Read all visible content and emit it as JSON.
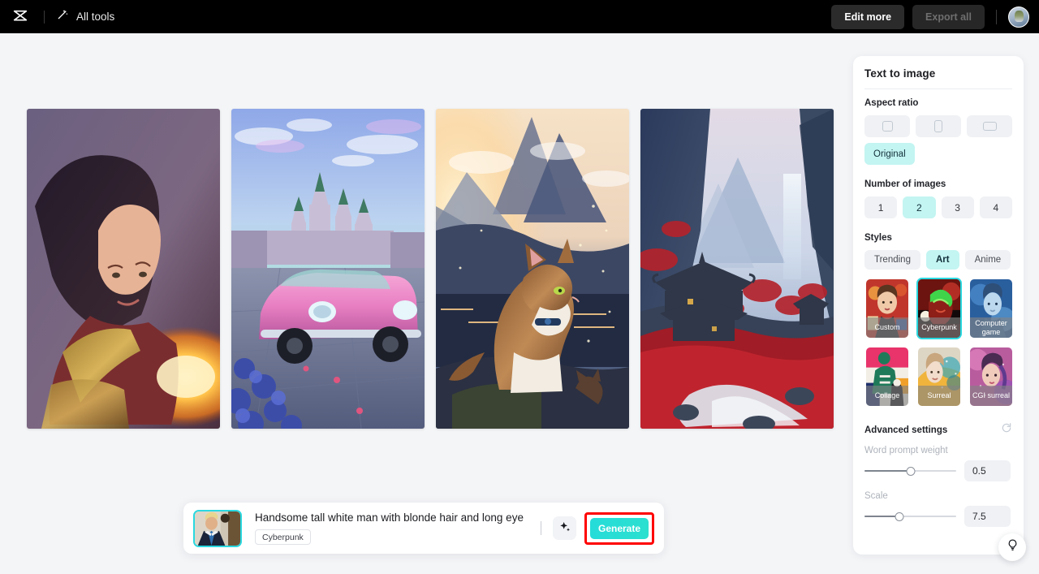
{
  "topbar": {
    "logo_icon": "capcut-logo-icon",
    "all_tools": {
      "icon": "magic-wand-icon",
      "label": "All tools"
    },
    "edit_more_label": "Edit more",
    "export_all_label": "Export all",
    "avatar_alt": "user-avatar"
  },
  "gallery": {
    "items": [
      {
        "name": "fantasy-warrior-woman",
        "alt": "Dark-haired warrior woman in gold armor with fireball"
      },
      {
        "name": "pink-car-castle",
        "alt": "Pink sports car in front of fairytale castle with blue flowers"
      },
      {
        "name": "cat-sunset-mountains",
        "alt": "Tabby cat on a rock at sunset with mountains and kitten"
      },
      {
        "name": "red-valley-pagoda",
        "alt": "Misty mountain valley with pagoda, red foliage and waterfall"
      }
    ]
  },
  "panel": {
    "title": "Text to image",
    "aspect_ratio": {
      "label": "Aspect ratio",
      "options": [
        {
          "icon": "square-ratio-icon",
          "selected": false
        },
        {
          "icon": "portrait-ratio-icon",
          "selected": false
        },
        {
          "icon": "landscape-ratio-icon",
          "selected": false
        }
      ],
      "original_label": "Original",
      "original_selected": true
    },
    "number_of_images": {
      "label": "Number of images",
      "options": [
        "1",
        "2",
        "3",
        "4"
      ],
      "selected": "2"
    },
    "styles": {
      "label": "Styles",
      "tabs": [
        {
          "label": "Trending",
          "active": false
        },
        {
          "label": "Art",
          "active": true
        },
        {
          "label": "Anime",
          "active": false
        }
      ],
      "items": [
        {
          "label": "Custom",
          "selected": false
        },
        {
          "label": "Cyberpunk",
          "selected": true
        },
        {
          "label": "Computer game",
          "selected": false
        },
        {
          "label": "Collage",
          "selected": false
        },
        {
          "label": "Surreal",
          "selected": false
        },
        {
          "label": "CGI surreal",
          "selected": false
        }
      ]
    },
    "advanced": {
      "title": "Advanced settings",
      "reset_icon": "reset-icon",
      "word_prompt_weight": {
        "label": "Word prompt weight",
        "value": "0.5",
        "percent": 50
      },
      "scale": {
        "label": "Scale",
        "value": "7.5",
        "percent": 38
      }
    }
  },
  "prompt_bar": {
    "reference_thumb_alt": "reference-image-man-in-suit",
    "text": "Handsome tall white man with blonde hair and long eye",
    "tag": "Cyberpunk",
    "magic_icon": "sparkle-icon",
    "generate_label": "Generate",
    "highlight_color": "#ff0000"
  },
  "help_fab": {
    "icon": "lightbulb-icon"
  },
  "colors": {
    "accent": "#2ad8e0",
    "chip": "#c3f5f2",
    "topbar": "#000000",
    "canvas": "#f4f5f7"
  }
}
